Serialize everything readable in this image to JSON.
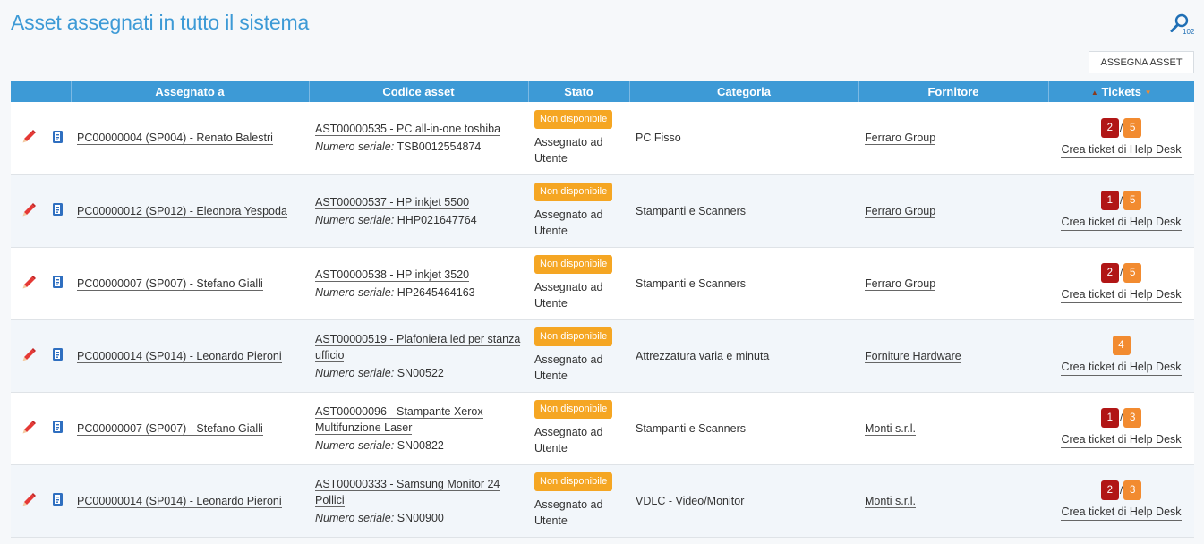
{
  "page": {
    "title": "Asset assegnati in tutto il sistema",
    "search_count": "102",
    "assign_button": "ASSEGNA ASSET"
  },
  "colors": {
    "header_bg": "#3d9ad6",
    "badge": "#f5a623",
    "ticket_red": "#b11616",
    "ticket_orange": "#f28b30"
  },
  "table": {
    "headers": {
      "assigned_to": "Assegnato a",
      "asset_code": "Codice asset",
      "status": "Stato",
      "category": "Categoria",
      "supplier": "Fornitore",
      "tickets": "Tickets"
    },
    "rows": [
      {
        "assigned_to": "PC00000004 (SP004) - Renato Balestri",
        "asset_code": "AST00000535 - PC all-in-one toshiba",
        "serial_label": "Numero seriale:",
        "serial": "TSB0012554874",
        "badge": "Non disponibile",
        "status": "Assegnato ad Utente",
        "category": "PC Fisso",
        "supplier": "Ferraro Group",
        "ticket_open": "2",
        "ticket_sep": "/",
        "ticket_total": "5",
        "help_link": "Crea ticket di Help Desk"
      },
      {
        "assigned_to": "PC00000012 (SP012) - Eleonora Yespoda",
        "asset_code": "AST00000537 - HP inkjet 5500",
        "serial_label": "Numero seriale:",
        "serial": "HHP021647764",
        "badge": "Non disponibile",
        "status": "Assegnato ad Utente",
        "category": "Stampanti e Scanners",
        "supplier": "Ferraro Group",
        "ticket_open": "1",
        "ticket_sep": "/",
        "ticket_total": "5",
        "help_link": "Crea ticket di Help Desk"
      },
      {
        "assigned_to": "PC00000007 (SP007) - Stefano Gialli",
        "asset_code": "AST00000538 - HP inkjet 3520",
        "serial_label": "Numero seriale:",
        "serial": "HP2645464163",
        "badge": "Non disponibile",
        "status": "Assegnato ad Utente",
        "category": "Stampanti e Scanners",
        "supplier": "Ferraro Group",
        "ticket_open": "2",
        "ticket_sep": "/",
        "ticket_total": "5",
        "help_link": "Crea ticket di Help Desk"
      },
      {
        "assigned_to": "PC00000014 (SP014) - Leonardo Pieroni",
        "asset_code": "AST00000519 - Plafoniera led per stanza ufficio",
        "serial_label": "Numero seriale:",
        "serial": "SN00522",
        "badge": "Non disponibile",
        "status": "Assegnato ad Utente",
        "category": "Attrezzatura varia e minuta",
        "supplier": "Forniture Hardware",
        "ticket_open": "",
        "ticket_sep": "",
        "ticket_total": "4",
        "help_link": "Crea ticket di Help Desk"
      },
      {
        "assigned_to": "PC00000007 (SP007) - Stefano Gialli",
        "asset_code": "AST00000096 - Stampante Xerox Multifunzione Laser",
        "serial_label": "Numero seriale:",
        "serial": "SN00822",
        "badge": "Non disponibile",
        "status": "Assegnato ad Utente",
        "category": "Stampanti e Scanners",
        "supplier": "Monti s.r.l.",
        "ticket_open": "1",
        "ticket_sep": "/",
        "ticket_total": "3",
        "help_link": "Crea ticket di Help Desk"
      },
      {
        "assigned_to": "PC00000014 (SP014) - Leonardo Pieroni",
        "asset_code": "AST00000333 - Samsung Monitor 24 Pollici",
        "serial_label": "Numero seriale:",
        "serial": "SN00900",
        "badge": "Non disponibile",
        "status": "Assegnato ad Utente",
        "category": "VDLC - Video/Monitor",
        "supplier": "Monti s.r.l.",
        "ticket_open": "2",
        "ticket_sep": "/",
        "ticket_total": "3",
        "help_link": "Crea ticket di Help Desk"
      }
    ]
  }
}
